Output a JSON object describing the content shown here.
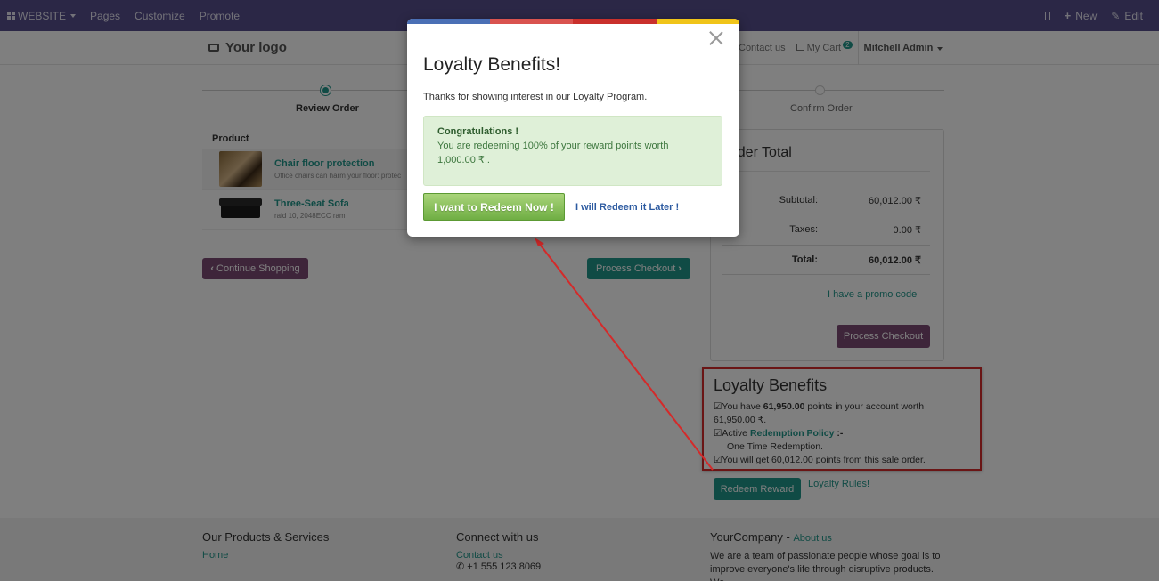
{
  "topbar": {
    "website_label": "WEBSITE",
    "pages_label": "Pages",
    "customize_label": "Customize",
    "promote_label": "Promote",
    "new_label": "New",
    "edit_label": "Edit"
  },
  "navbar": {
    "logo_text": "Your logo",
    "contact_label": "Contact us",
    "cart_label": "My Cart",
    "cart_count": "2",
    "user_label": "Mitchell Admin"
  },
  "wizard": {
    "step1": "Review Order",
    "step3": "Confirm Order"
  },
  "cart": {
    "header": "Product",
    "items": [
      {
        "name": "Chair floor protection",
        "desc": "Office chairs can harm your floor: protec"
      },
      {
        "name": "Three-Seat Sofa",
        "desc": "raid 10, 2048ECC ram"
      }
    ],
    "continue_label": "Continue Shopping",
    "checkout_label": "Process Checkout"
  },
  "order_total": {
    "title": "Order Total",
    "subtotal_label": "Subtotal:",
    "subtotal_value": "60,012.00 ₹",
    "taxes_label": "Taxes:",
    "taxes_value": "0.00 ₹",
    "total_label": "Total:",
    "total_value": "60,012.00 ₹",
    "promo_label": "I have a promo code",
    "checkout_label": "Process Checkout"
  },
  "loyalty": {
    "title": "Loyalty Benefits",
    "line1_prefix": "☑You have ",
    "points": "61,950.00",
    "line1_suffix": " points in your account worth",
    "line1_worth": "61,950.00 ₹.",
    "line2_prefix": "☑Active ",
    "policy_label": "Redemption Policy",
    "line2_suffix": " :-",
    "policy_value": "One Time Redemption.",
    "line3": "☑You will get 60,012.00 points from this sale order.",
    "redeem_button": "Redeem Reward",
    "rules_link": "Loyalty Rules!"
  },
  "footer": {
    "col1_title": "Our Products & Services",
    "col1_link": "Home",
    "col2_title": "Connect with us",
    "col2_link": "Contact us",
    "col2_phone": "+1 555 123 8069",
    "col3_title": "YourCompany",
    "col3_sep": " - ",
    "col3_link": "About us",
    "col3_text": "We are a team of passionate people whose goal is to improve everyone's life through disruptive products. We"
  },
  "modal": {
    "title": "Loyalty Benefits!",
    "intro": "Thanks for showing interest in our Loyalty Program.",
    "alert_title": "Congratulations !",
    "alert_text1": "You are redeeming 100% of your reward points worth",
    "alert_text2": "1,000.00 ₹ .",
    "redeem_now": "I want to Redeem Now !",
    "redeem_later": "I will Redeem it Later !",
    "bar_colors": [
      "#4a6fb5",
      "#d9534f",
      "#c9302c",
      "#f0c419"
    ]
  },
  "colors": {
    "topbar": "#564f8c",
    "accent": "#21968a",
    "purple": "#7c4a75",
    "highlight": "#d42a2a"
  }
}
